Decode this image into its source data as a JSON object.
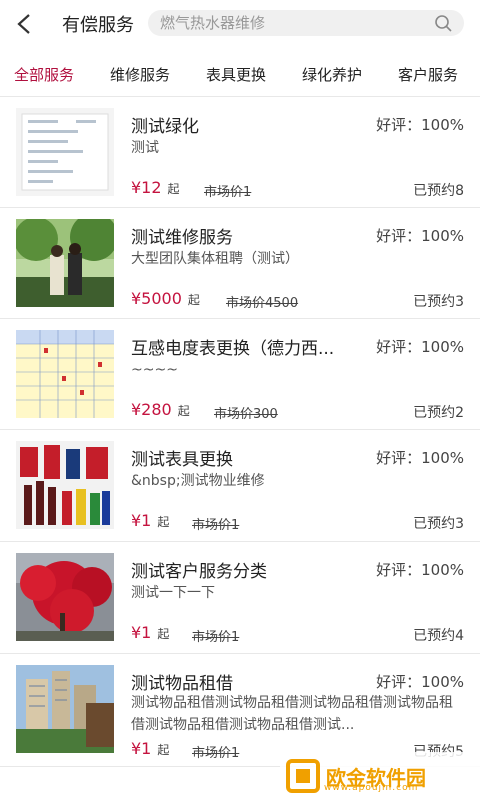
{
  "header": {
    "title": "有偿服务",
    "search_placeholder": "燃气热水器维修"
  },
  "tabs": [
    {
      "label": "全部服务",
      "active": true
    },
    {
      "label": "维修服务",
      "active": false
    },
    {
      "label": "表具更换",
      "active": false
    },
    {
      "label": "绿化养护",
      "active": false
    },
    {
      "label": "客户服务",
      "active": false
    }
  ],
  "items": [
    {
      "name": "测试绿化",
      "rating": "好评：100%",
      "desc": "测试",
      "price": "¥12",
      "unit": "起",
      "market": "市场价1",
      "booked": "已预约8"
    },
    {
      "name": "测试维修服务",
      "rating": "好评：100%",
      "desc": "大型团队集体租聘（测试）",
      "price": "¥5000",
      "unit": "起",
      "market": "市场价4500",
      "booked": "已预约3"
    },
    {
      "name": "互感电度表更换（德力西...",
      "rating": "好评：100%",
      "desc": "~~~~",
      "price": "¥280",
      "unit": "起",
      "market": "市场价300",
      "booked": "已预约2"
    },
    {
      "name": "测试表具更换",
      "rating": "好评：100%",
      "desc": "&nbsp;测试物业维修",
      "price": "¥1",
      "unit": "起",
      "market": "市场价1",
      "booked": "已预约3"
    },
    {
      "name": "测试客户服务分类",
      "rating": "好评：100%",
      "desc": "测试一下一下",
      "price": "¥1",
      "unit": "起",
      "market": "市场价1",
      "booked": "已预约4"
    },
    {
      "name": "测试物品租借",
      "rating": "好评：100%",
      "desc": "测试物品租借测试物品租借测试物品租借测试物品租借测试物品租借测试物品租借测试...",
      "price": "¥1",
      "unit": "起",
      "market": "市场价1",
      "booked": "已预约5"
    }
  ],
  "watermark": {
    "text": "欧金软件园",
    "url": "www.apoujin.com"
  },
  "colors": {
    "accent": "#b0103e",
    "price": "#c4133f",
    "watermark": "#f0a000"
  }
}
